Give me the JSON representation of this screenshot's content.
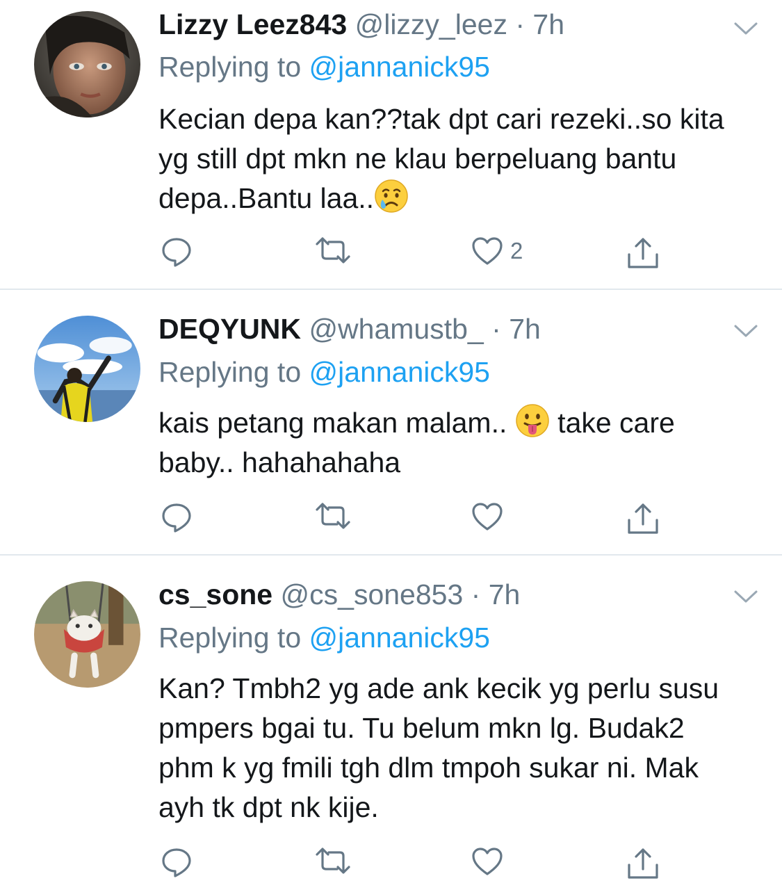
{
  "tweets": [
    {
      "display_name": "Lizzy Leez843",
      "handle": "@lizzy_leez",
      "time": "7h",
      "replying_prefix": "Replying to",
      "replying_to": "@jannanick95",
      "text_before_emoji": "Kecian depa kan??tak dpt cari rezeki..so kita yg still dpt mkn ne klau berpeluang bantu depa..Bantu laa..",
      "emoji": "crying-face",
      "text_after_emoji": "",
      "like_count": "2"
    },
    {
      "display_name": "DEQYUNK",
      "handle": "@whamustb_",
      "time": "7h",
      "replying_prefix": "Replying to",
      "replying_to": "@jannanick95",
      "text_before_emoji": "kais petang makan malam..",
      "emoji": "face-with-tongue",
      "text_after_emoji": "take care baby.. hahahahaha",
      "like_count": ""
    },
    {
      "display_name": "cs_sone",
      "handle": "@cs_sone853",
      "time": "7h",
      "replying_prefix": "Replying to",
      "replying_to": "@jannanick95",
      "text_before_emoji": "Kan? Tmbh2 yg ade ank kecik yg perlu susu pmpers bgai tu. Tu belum  mkn lg. Budak2 phm k yg fmili tgh dlm tmpoh sukar ni. Mak ayh tk dpt nk kije.",
      "emoji": "",
      "text_after_emoji": "",
      "like_count": ""
    }
  ],
  "separator": "·",
  "icons": {
    "reply": "reply-icon",
    "retweet": "retweet-icon",
    "like": "heart-icon",
    "share": "share-icon",
    "menu": "chevron-down-icon"
  },
  "colors": {
    "text": "#14171a",
    "secondary": "#657786",
    "link": "#1da1f2",
    "divider": "#e1e8ed"
  }
}
